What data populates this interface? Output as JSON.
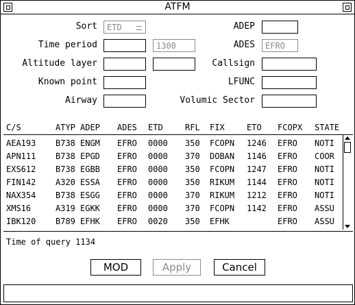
{
  "window": {
    "title": "ATFM"
  },
  "form": {
    "sort_label": "Sort",
    "sort_value": "ETD",
    "time_period_label": "Time period",
    "time_period_from": "",
    "time_period_to": "1300",
    "altitude_layer_label": "Altitude layer",
    "altitude_from": "",
    "altitude_to": "",
    "known_point_label": "Known point",
    "known_point_value": "",
    "airway_label": "Airway",
    "airway_value": "",
    "adep_label": "ADEP",
    "adep_value": "",
    "ades_label": "ADES",
    "ades_value": "EFRO",
    "callsign_label": "Callsign",
    "callsign_value": "",
    "lfunc_label": "LFUNC",
    "lfunc_value": "",
    "volumic_sector_label": "Volumic Sector",
    "volumic_sector_value": ""
  },
  "table": {
    "columns": [
      "C/S",
      "ATYP",
      "ADEP",
      "ADES",
      "ETD",
      "RFL",
      "FIX",
      "ETO",
      "FCOPX",
      "STATE"
    ],
    "rows": [
      [
        "AEA193",
        "B738",
        "ENGM",
        "EFRO",
        "0000",
        "350",
        "FCOPN",
        "1246",
        "EFRO",
        "NOTI"
      ],
      [
        "APN111",
        "B738",
        "EPGD",
        "EFRO",
        "0000",
        "370",
        "DOBAN",
        "1146",
        "EFRO",
        "COOR"
      ],
      [
        "EXS612",
        "B738",
        "EGBB",
        "EFRO",
        "0000",
        "350",
        "FCOPN",
        "1247",
        "EFRO",
        "NOTI"
      ],
      [
        "FIN142",
        "A320",
        "ESSA",
        "EFRO",
        "0000",
        "350",
        "RIKUM",
        "1144",
        "EFRO",
        "NOTI"
      ],
      [
        "NAX354",
        "B738",
        "ESGG",
        "EFRO",
        "0000",
        "370",
        "RIKUM",
        "1212",
        "EFRO",
        "NOTI"
      ],
      [
        "XMS16",
        "A319",
        "EGKK",
        "EFRO",
        "0000",
        "370",
        "FCOPN",
        "1142",
        "EFRO",
        "ASSU"
      ],
      [
        "IBK120",
        "B789",
        "EFHK",
        "EFRO",
        "0020",
        "350",
        "EFHK",
        "",
        "EFRO",
        "ASSU"
      ]
    ]
  },
  "status": {
    "query_time": "Time of query 1134"
  },
  "buttons": {
    "mod": "MOD",
    "apply": "Apply",
    "cancel": "Cancel"
  },
  "command_line": {
    "value": ""
  }
}
